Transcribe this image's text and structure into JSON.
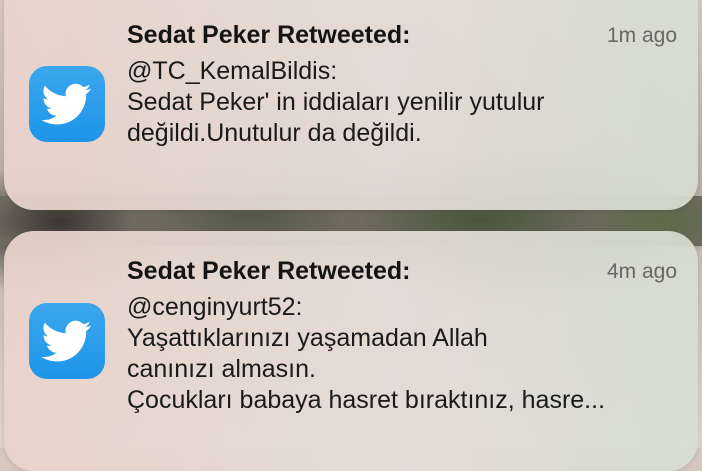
{
  "notifications": [
    {
      "app_icon": "twitter-bird-icon",
      "title": "Sedat Peker Retweeted:",
      "time": "1m ago",
      "lines": [
        "@TC_KemalBildis:",
        "Sedat Peker' in iddiaları yenilir yutulur",
        "değildi.Unutulur da değildi."
      ]
    },
    {
      "app_icon": "twitter-bird-icon",
      "title": "Sedat Peker Retweeted:",
      "time": "4m ago",
      "lines": [
        "@cenginyurt52:",
        "Yaşattıklarınızı yaşamadan Allah",
        "canınızı almasın.",
        "Çocukları babaya hasret bıraktınız, hasre..."
      ]
    }
  ],
  "colors": {
    "twitter_blue": "#1d95e8",
    "card_background": "#e6dad3"
  }
}
